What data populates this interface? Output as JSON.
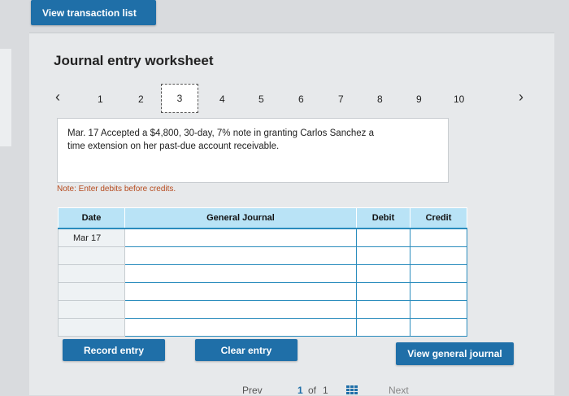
{
  "top_button": "View transaction list",
  "title": "Journal entry worksheet",
  "pager": {
    "prev_icon": "chevron-left-icon",
    "next_icon": "chevron-right-icon",
    "pages": [
      "1",
      "2",
      "3",
      "4",
      "5",
      "6",
      "7",
      "8",
      "9",
      "10"
    ],
    "current": "3"
  },
  "description": {
    "line1": "Mar. 17 Accepted a $4,800, 30-day, 7% note in granting Carlos Sanchez a",
    "line2": "time extension on her past-due account receivable."
  },
  "note": "Note: Enter debits before credits.",
  "table": {
    "headers": [
      "Date",
      "General Journal",
      "Debit",
      "Credit"
    ],
    "rows": [
      [
        "Mar 17",
        "",
        "",
        ""
      ],
      [
        "",
        "",
        "",
        ""
      ],
      [
        "",
        "",
        "",
        ""
      ],
      [
        "",
        "",
        "",
        ""
      ],
      [
        "",
        "",
        "",
        ""
      ],
      [
        "",
        "",
        "",
        ""
      ]
    ]
  },
  "buttons": {
    "record": "Record entry",
    "clear": "Clear entry",
    "view_general_journal": "View general journal"
  },
  "footer": {
    "prev": "Prev",
    "page_current": "1",
    "of": "of",
    "page_total": "1",
    "next": "Next",
    "grid_icon": "grid-icon"
  },
  "colors": {
    "button_blue": "#1f6fa8",
    "table_header": "#b9e3f6",
    "table_border": "#2a8cbd",
    "note_color": "#b64a1d"
  }
}
